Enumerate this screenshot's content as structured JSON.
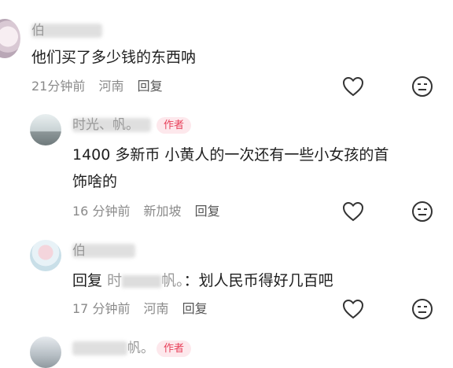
{
  "comments": [
    {
      "name": "伯",
      "text": "他们买了多少钱的东西呐",
      "time": "21分钟前",
      "location": "河南",
      "reply_label": "回复"
    },
    {
      "name": "时光、帆。",
      "author_badge": "作者",
      "text_line1": "1400 多新币 小黄人的一次还有一些小女孩的首",
      "text_line2": "饰啥的",
      "time": "16 分钟前",
      "location": "新加坡",
      "reply_label": "回复"
    },
    {
      "name": "伯",
      "reply_prefix": "回复",
      "reply_to": "时",
      "reply_to_tail": "帆。",
      "text": "：划人民币得好几百吧",
      "time": "17 分钟前",
      "location": "河南",
      "reply_label": "回复"
    },
    {
      "name_tail": "帆。",
      "author_badge": "作者"
    }
  ],
  "icons": {
    "like": "heart-icon",
    "dislike": "neutral-face-icon"
  }
}
